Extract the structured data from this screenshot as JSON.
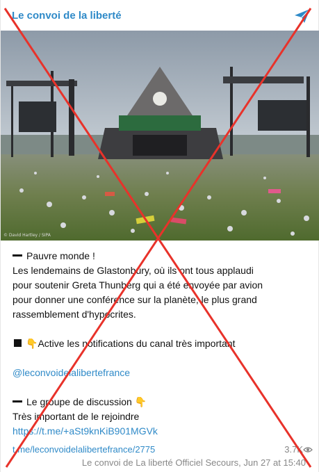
{
  "header": {
    "channel_name": "Le convoi de la liberté"
  },
  "photo": {
    "credit": "© David Hartley / SIPA"
  },
  "post": {
    "line1": "Pauvre monde !",
    "line2": "Les lendemains de Glastonbury, où ils ont tous applaudi",
    "line3": "pour soutenir Greta Thunberg qui a été envoyée par avion",
    "line4": "pour donner une conférence sur la planète, le plus grand",
    "line5": "rassemblement d'hypocrites.",
    "notify": "Active les notifications du canal très important",
    "handle": "@leconvoidelalibertefrance",
    "group": "Le groupe de discussion",
    "group_note": "Très important de le rejoindre",
    "invite_link": "https://t.me/+aSt9knKiB901MGVk"
  },
  "footer": {
    "post_link": "t.me/leconvoidelalibertefrance/2775",
    "views": "3.7K",
    "signature": "Le convoi de La liberté Officiel Secours, Jun 27 at 15:40"
  },
  "colors": {
    "link": "#2f8ac8",
    "cross": "#e8322a"
  }
}
